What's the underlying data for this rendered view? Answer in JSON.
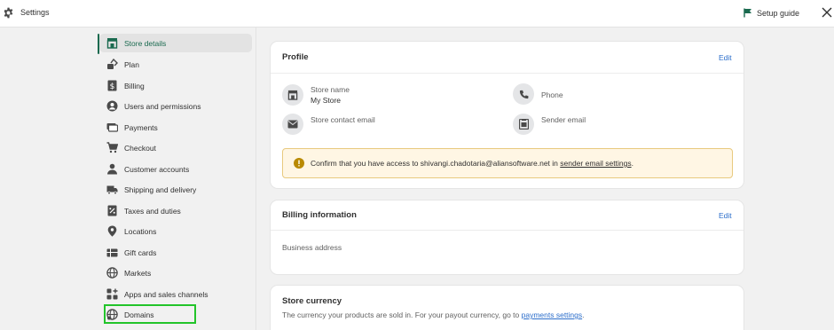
{
  "header": {
    "title": "Settings",
    "setup_guide": "Setup guide"
  },
  "sidebar": {
    "items": [
      {
        "label": "Store details",
        "icon": "store-icon"
      },
      {
        "label": "Plan",
        "icon": "plan-icon"
      },
      {
        "label": "Billing",
        "icon": "billing-icon"
      },
      {
        "label": "Users and permissions",
        "icon": "user-circle-icon"
      },
      {
        "label": "Payments",
        "icon": "payments-icon"
      },
      {
        "label": "Checkout",
        "icon": "cart-icon"
      },
      {
        "label": "Customer accounts",
        "icon": "person-icon"
      },
      {
        "label": "Shipping and delivery",
        "icon": "truck-icon"
      },
      {
        "label": "Taxes and duties",
        "icon": "tax-icon"
      },
      {
        "label": "Locations",
        "icon": "location-pin-icon"
      },
      {
        "label": "Gift cards",
        "icon": "gift-card-icon"
      },
      {
        "label": "Markets",
        "icon": "globe-icon"
      },
      {
        "label": "Apps and sales channels",
        "icon": "apps-icon"
      },
      {
        "label": "Domains",
        "icon": "domain-globe-icon"
      }
    ]
  },
  "profile": {
    "title": "Profile",
    "edit": "Edit",
    "store_name_label": "Store name",
    "store_name_value": "My Store",
    "phone_label": "Phone",
    "contact_email_label": "Store contact email",
    "sender_email_label": "Sender email",
    "banner_text": "Confirm that you have access to shivangi.chadotaria@aliansoftware.net in",
    "banner_link": "sender email settings",
    "banner_end": "."
  },
  "billing": {
    "title": "Billing information",
    "edit": "Edit",
    "business_address_label": "Business address"
  },
  "currency": {
    "title": "Store currency",
    "desc": "The currency your products are sold in. For your payout currency, go to",
    "link": "payments settings",
    "end": "."
  },
  "colors": {
    "accent": "#1a6a4f",
    "link": "#2c6ecb",
    "highlight_box": "#22c42a",
    "warning_bg": "#fff6e4"
  }
}
